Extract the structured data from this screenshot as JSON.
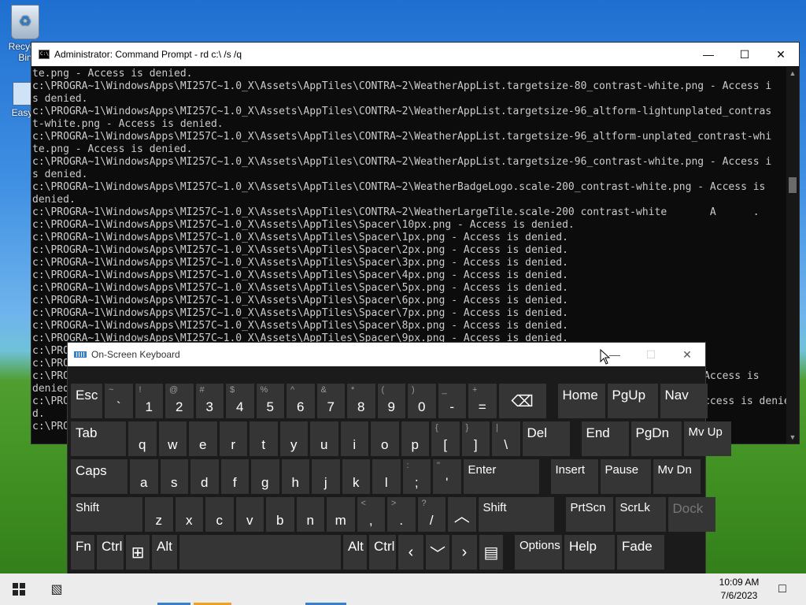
{
  "desktop": {
    "icons": [
      {
        "label": "Recycle Bin"
      },
      {
        "label": "EasyB"
      }
    ]
  },
  "cmd": {
    "title": "Administrator: Command Prompt - rd  c:\\ /s /q",
    "lines": [
      "te.png - Access is denied.",
      "c:\\PROGRA~1\\WindowsApps\\MI257C~1.0_X\\Assets\\AppTiles\\CONTRA~2\\WeatherAppList.targetsize-80_contrast-white.png - Access i",
      "s denied.",
      "c:\\PROGRA~1\\WindowsApps\\MI257C~1.0_X\\Assets\\AppTiles\\CONTRA~2\\WeatherAppList.targetsize-96_altform-lightunplated_contras",
      "t-white.png - Access is denied.",
      "c:\\PROGRA~1\\WindowsApps\\MI257C~1.0_X\\Assets\\AppTiles\\CONTRA~2\\WeatherAppList.targetsize-96_altform-unplated_contrast-whi",
      "te.png - Access is denied.",
      "c:\\PROGRA~1\\WindowsApps\\MI257C~1.0_X\\Assets\\AppTiles\\CONTRA~2\\WeatherAppList.targetsize-96_contrast-white.png - Access i",
      "s denied.",
      "c:\\PROGRA~1\\WindowsApps\\MI257C~1.0_X\\Assets\\AppTiles\\CONTRA~2\\WeatherBadgeLogo.scale-200_contrast-white.png - Access is",
      "denied.",
      "c:\\PROGRA~1\\WindowsApps\\MI257C~1.0_X\\Assets\\AppTiles\\CONTRA~2\\WeatherLargeTile.scale-200 contrast-white       A      .",
      "c:\\PROGRA~1\\WindowsApps\\MI257C~1.0_X\\Assets\\AppTiles\\Spacer\\10px.png - Access is denied.",
      "c:\\PROGRA~1\\WindowsApps\\MI257C~1.0_X\\Assets\\AppTiles\\Spacer\\1px.png - Access is denied.",
      "c:\\PROGRA~1\\WindowsApps\\MI257C~1.0_X\\Assets\\AppTiles\\Spacer\\2px.png - Access is denied.",
      "c:\\PROGRA~1\\WindowsApps\\MI257C~1.0_X\\Assets\\AppTiles\\Spacer\\3px.png - Access is denied.",
      "c:\\PROGRA~1\\WindowsApps\\MI257C~1.0_X\\Assets\\AppTiles\\Spacer\\4px.png - Access is denied.",
      "c:\\PROGRA~1\\WindowsApps\\MI257C~1.0_X\\Assets\\AppTiles\\Spacer\\5px.png - Access is denied.",
      "c:\\PROGRA~1\\WindowsApps\\MI257C~1.0_X\\Assets\\AppTiles\\Spacer\\6px.png - Access is denied.",
      "c:\\PROGRA~1\\WindowsApps\\MI257C~1.0_X\\Assets\\AppTiles\\Spacer\\7px.png - Access is denied.",
      "c:\\PROGRA~1\\WindowsApps\\MI257C~1.0_X\\Assets\\AppTiles\\Spacer\\8px.png - Access is denied.",
      "c:\\PROGRA~1\\WindowsApps\\MI257C~1.0_X\\Assets\\AppTiles\\Spacer\\9px.png - Access is denied.",
      "c:\\PRO",
      "c:\\PRO",
      "c:\\PRO                                                                                                     - Access is",
      "denied",
      "c:\\PRO                                                                                                       ccess is denie",
      "d.",
      "c:\\PRO"
    ]
  },
  "osk": {
    "title": "On-Screen Keyboard",
    "rows": [
      [
        {
          "id": "esc",
          "label": "Esc"
        },
        {
          "id": "backtick",
          "shift": "~",
          "main": "`"
        },
        {
          "id": "1",
          "shift": "!",
          "main": "1"
        },
        {
          "id": "2",
          "shift": "@",
          "main": "2"
        },
        {
          "id": "3",
          "shift": "#",
          "main": "3"
        },
        {
          "id": "4",
          "shift": "$",
          "main": "4"
        },
        {
          "id": "5",
          "shift": "%",
          "main": "5"
        },
        {
          "id": "6",
          "shift": "^",
          "main": "6"
        },
        {
          "id": "7",
          "shift": "&",
          "main": "7"
        },
        {
          "id": "8",
          "shift": "*",
          "main": "8"
        },
        {
          "id": "9",
          "shift": "(",
          "main": "9"
        },
        {
          "id": "0",
          "shift": ")",
          "main": "0"
        },
        {
          "id": "minus",
          "shift": "_",
          "main": "-"
        },
        {
          "id": "equals",
          "shift": "+",
          "main": "="
        },
        {
          "id": "backspace",
          "glyph": "⌫"
        },
        {
          "id": "home",
          "label": "Home"
        },
        {
          "id": "pgup",
          "label": "PgUp"
        },
        {
          "id": "nav",
          "label": "Nav"
        }
      ],
      [
        {
          "id": "tab",
          "label": "Tab"
        },
        {
          "id": "q",
          "main": "q"
        },
        {
          "id": "w",
          "main": "w"
        },
        {
          "id": "e",
          "main": "e"
        },
        {
          "id": "r",
          "main": "r"
        },
        {
          "id": "t",
          "main": "t"
        },
        {
          "id": "y",
          "main": "y"
        },
        {
          "id": "u",
          "main": "u"
        },
        {
          "id": "i",
          "main": "i"
        },
        {
          "id": "o",
          "main": "o"
        },
        {
          "id": "p",
          "main": "p"
        },
        {
          "id": "lbracket",
          "shift": "{",
          "main": "["
        },
        {
          "id": "rbracket",
          "shift": "}",
          "main": "]"
        },
        {
          "id": "backslash",
          "shift": "|",
          "main": "\\"
        },
        {
          "id": "del",
          "label": "Del"
        },
        {
          "id": "end",
          "label": "End"
        },
        {
          "id": "pgdn",
          "label": "PgDn"
        },
        {
          "id": "mvup",
          "label": "Mv Up"
        }
      ],
      [
        {
          "id": "caps",
          "label": "Caps"
        },
        {
          "id": "a",
          "main": "a"
        },
        {
          "id": "s",
          "main": "s"
        },
        {
          "id": "d",
          "main": "d"
        },
        {
          "id": "f",
          "main": "f"
        },
        {
          "id": "g",
          "main": "g"
        },
        {
          "id": "h",
          "main": "h"
        },
        {
          "id": "j",
          "main": "j"
        },
        {
          "id": "k",
          "main": "k"
        },
        {
          "id": "l",
          "main": "l"
        },
        {
          "id": "semicolon",
          "shift": ":",
          "main": ";"
        },
        {
          "id": "quote",
          "shift": "\"",
          "main": "'"
        },
        {
          "id": "enter",
          "label": "Enter"
        },
        {
          "id": "insert",
          "label": "Insert"
        },
        {
          "id": "pause",
          "label": "Pause"
        },
        {
          "id": "mvdn",
          "label": "Mv Dn"
        }
      ],
      [
        {
          "id": "shift-left",
          "label": "Shift"
        },
        {
          "id": "z",
          "main": "z"
        },
        {
          "id": "x",
          "main": "x"
        },
        {
          "id": "c",
          "main": "c"
        },
        {
          "id": "v",
          "main": "v"
        },
        {
          "id": "b",
          "main": "b"
        },
        {
          "id": "n",
          "main": "n"
        },
        {
          "id": "m",
          "main": "m"
        },
        {
          "id": "comma",
          "shift": "<",
          "main": ","
        },
        {
          "id": "period",
          "shift": ">",
          "main": "."
        },
        {
          "id": "slash",
          "shift": "?",
          "main": "/"
        },
        {
          "id": "up",
          "glyph": "︿"
        },
        {
          "id": "shift-right",
          "label": "Shift"
        },
        {
          "id": "prtscn",
          "label": "PrtScn"
        },
        {
          "id": "scrlk",
          "label": "ScrLk"
        },
        {
          "id": "dock",
          "label": "Dock"
        }
      ],
      [
        {
          "id": "fn",
          "label": "Fn"
        },
        {
          "id": "ctrl-left",
          "label": "Ctrl"
        },
        {
          "id": "win",
          "glyph": "⊞"
        },
        {
          "id": "alt-left",
          "label": "Alt"
        },
        {
          "id": "space",
          "main": ""
        },
        {
          "id": "alt-right",
          "label": "Alt"
        },
        {
          "id": "ctrl-right",
          "label": "Ctrl"
        },
        {
          "id": "left",
          "glyph": "‹"
        },
        {
          "id": "down",
          "glyph": "﹀"
        },
        {
          "id": "right",
          "glyph": "›"
        },
        {
          "id": "menu",
          "glyph": "▤"
        },
        {
          "id": "options",
          "label": "Options"
        },
        {
          "id": "help",
          "label": "Help"
        },
        {
          "id": "fade",
          "label": "Fade"
        }
      ]
    ]
  },
  "taskbar": {
    "time": "10:09 AM",
    "date": "7/6/2023"
  },
  "colors": {
    "console_bg": "#0c0c0c",
    "console_text": "#cccccc",
    "key_bg": "#353535",
    "keyboard_bg": "#1b1b1b"
  }
}
